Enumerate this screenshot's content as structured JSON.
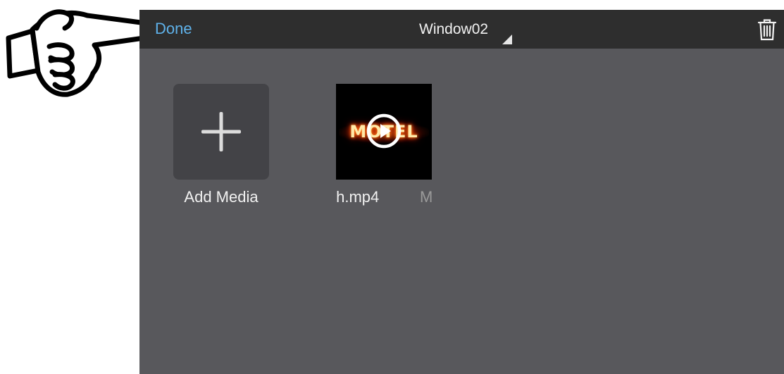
{
  "header": {
    "done_label": "Done",
    "window_title": "Window02"
  },
  "icons": {
    "dropdown": "dropdown-triangle-icon",
    "trash": "trash-icon",
    "add": "plus-icon",
    "play": "play-icon",
    "pointer": "pointing-hand-icon"
  },
  "media": {
    "add_label": "Add Media",
    "items": [
      {
        "filename": ":h.mp4",
        "extra": "M",
        "thumbnail_text": "MOTEL"
      }
    ]
  },
  "colors": {
    "accent": "#5fb2ea",
    "topbar": "#2e2e2e",
    "content": "#58585c",
    "tile": "#434347"
  }
}
